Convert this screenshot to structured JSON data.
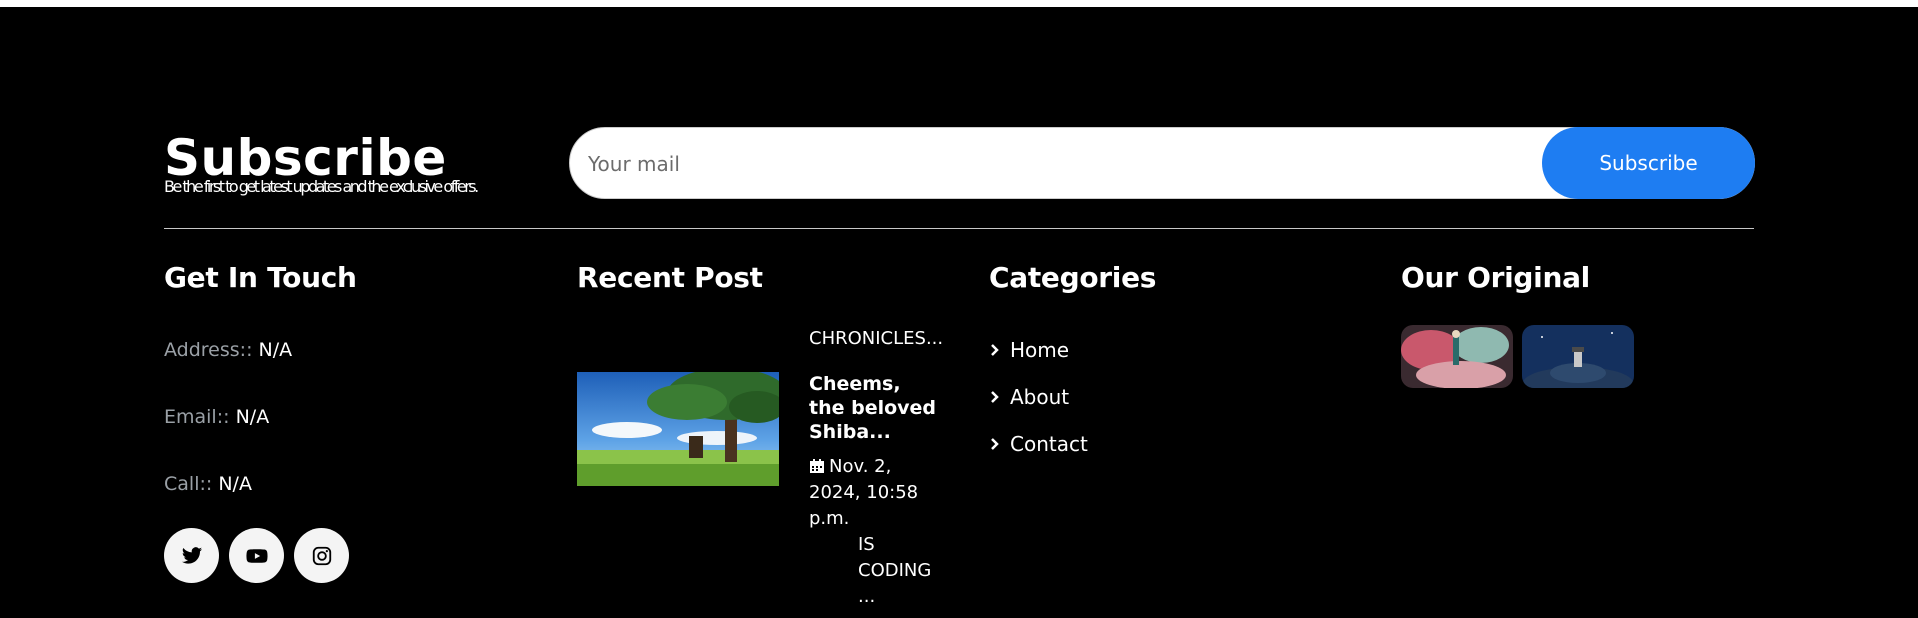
{
  "subscribe": {
    "title": "Subscribe",
    "text": "Be the first to get latest updates and the exclusive offers.",
    "input_placeholder": "Your mail",
    "button_label": "Subscribe"
  },
  "contact": {
    "title": "Get In Touch",
    "address_label": "Address::",
    "address_value": "N/A",
    "email_label": "Email::",
    "email_value": "N/A",
    "call_label": "Call::",
    "call_value": "N/A",
    "social": [
      "twitter-icon",
      "youtube-icon",
      "instagram-icon"
    ]
  },
  "recent_post": {
    "title": "Recent Post",
    "category": "CHRONICLES...",
    "post_title": "Cheems, the beloved Shiba...",
    "date": "Nov. 2, 2024, 10:58 p.m.",
    "tag": "IS CODING ..."
  },
  "categories": {
    "title": "Categories",
    "items": [
      "Home",
      "About",
      "Contact"
    ]
  },
  "original": {
    "title": "Our Original"
  },
  "colors": {
    "background": "#000000",
    "accent": "#1e7df2",
    "muted_label": "#9aa0a6"
  }
}
